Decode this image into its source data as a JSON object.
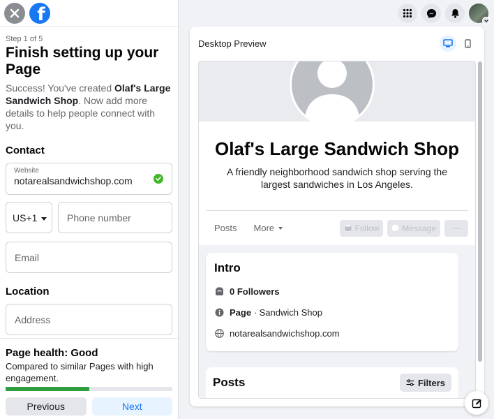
{
  "left": {
    "step": "Step 1 of 5",
    "title": "Finish setting up your Page",
    "desc_pre": "Success! You've created ",
    "desc_bold": "Olaf's Large Sandwich Shop",
    "desc_post": ". Now add more details to help people connect with you.",
    "contact_label": "Contact",
    "website_label": "Website",
    "website_value": "notarealsandwichshop.com",
    "country_code": "US+1",
    "phone_placeholder": "Phone number",
    "email_placeholder": "Email",
    "location_label": "Location",
    "address_placeholder": "Address",
    "health_title": "Page health: Good",
    "health_desc": "Compared to similar Pages with high engagement.",
    "health_progress": 0.5,
    "prev_label": "Previous",
    "next_label": "Next"
  },
  "top_icons": [
    "menu-grid-icon",
    "messenger-icon",
    "bell-icon",
    "profile-avatar"
  ],
  "preview": {
    "title": "Desktop Preview",
    "active_view": "desktop",
    "page_name": "Olaf's Large Sandwich Shop",
    "page_about": "A friendly neighborhood sandwich shop serving the largest sandwiches in Los Angeles.",
    "tabs": [
      "Posts",
      "More"
    ],
    "actions": {
      "follow": "Follow",
      "message": "Message",
      "more": "···"
    },
    "intro": {
      "title": "Intro",
      "followers": "0 Followers",
      "category_bold": "Page",
      "category_rest": " · Sandwich Shop",
      "website": "notarealsandwichshop.com"
    },
    "posts_title": "Posts",
    "filters_label": "Filters"
  },
  "colors": {
    "brand": "#1877f2",
    "success": "#42b72a",
    "health": "#2e9e3f"
  }
}
